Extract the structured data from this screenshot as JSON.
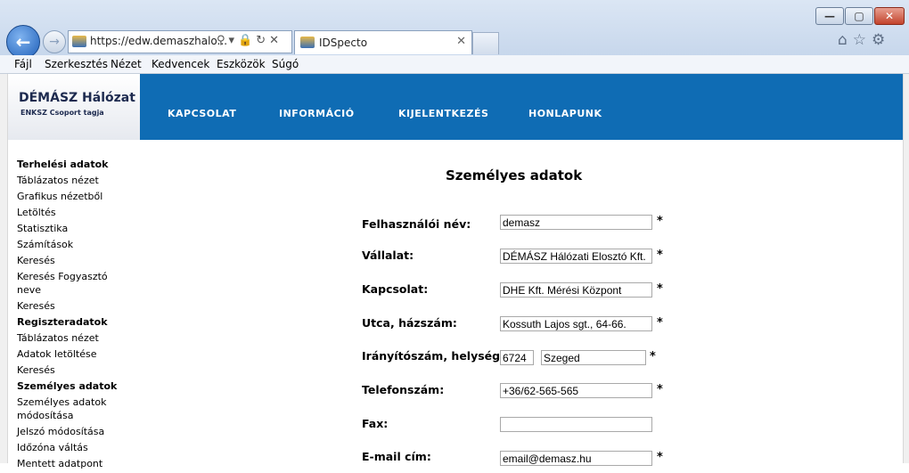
{
  "browser": {
    "url": "https://edw.demaszhalo...",
    "tab_title": "IDSpecto",
    "tab_close": "✕",
    "window": {
      "minimize": "—",
      "maximize": "▢",
      "close": "✕"
    },
    "icons": [
      "search-icon",
      "dropdown-icon",
      "lock-icon",
      "refresh-icon",
      "stop-icon",
      "home-icon",
      "favorites-star-icon",
      "gear-icon"
    ]
  },
  "menu": {
    "items": [
      "Fájl",
      "Szerkesztés",
      "Nézet",
      "Kedvencek",
      "Eszközök",
      "Súgó"
    ]
  },
  "logo": {
    "title": "DÉMÁSZ Hálózat",
    "subtitle": "ENKSZ Csoport tagja"
  },
  "nav": {
    "items": [
      "KAPCSOLAT",
      "INFORMÁCIÓ",
      "KIJELENTKEZÉS",
      "HONLAPUNK"
    ]
  },
  "sidebar": {
    "items": [
      {
        "label": "Terhelési adatok",
        "head": true
      },
      {
        "label": "Táblázatos nézet",
        "head": false
      },
      {
        "label": "Grafikus nézetből",
        "head": false
      },
      {
        "label": "Letöltés",
        "head": false
      },
      {
        "label": "Statisztika",
        "head": false
      },
      {
        "label": "Számítások",
        "head": false
      },
      {
        "label": "Keresés",
        "head": false
      },
      {
        "label": "Keresés Fogyasztó neve",
        "head": false
      },
      {
        "label": "Keresés",
        "head": false
      },
      {
        "label": "Regiszteradatok",
        "head": true
      },
      {
        "label": "Táblázatos nézet",
        "head": false
      },
      {
        "label": "Adatok letöltése",
        "head": false
      },
      {
        "label": "Keresés",
        "head": false
      },
      {
        "label": "Személyes adatok",
        "head": true
      },
      {
        "label": "Személyes adatok módosítása",
        "head": false
      },
      {
        "label": "Jelszó módosítása",
        "head": false
      },
      {
        "label": "Időzóna váltás",
        "head": false
      },
      {
        "label": "Mentett adatpont",
        "head": false
      }
    ]
  },
  "form": {
    "title": "Személyes adatok",
    "required_mark": "*",
    "fields": {
      "username": {
        "label": "Felhasználói név:",
        "value": "demasz"
      },
      "company": {
        "label": "Vállalat:",
        "value": "DÉMÁSZ Hálózati Elosztó Kft."
      },
      "contact": {
        "label": "Kapcsolat:",
        "value": "DHE Kft. Mérési Központ"
      },
      "street": {
        "label": "Utca, házszám:",
        "value": "Kossuth Lajos sgt., 64-66."
      },
      "zipcity": {
        "label": "Irányítószám, helység:",
        "zip": "6724",
        "city": "Szeged"
      },
      "phone": {
        "label": "Telefonszám:",
        "value": "+36/62-565-565"
      },
      "fax": {
        "label": "Fax:",
        "value": ""
      },
      "email": {
        "label": "E-mail cím:",
        "value": "email@demasz.hu"
      }
    }
  }
}
